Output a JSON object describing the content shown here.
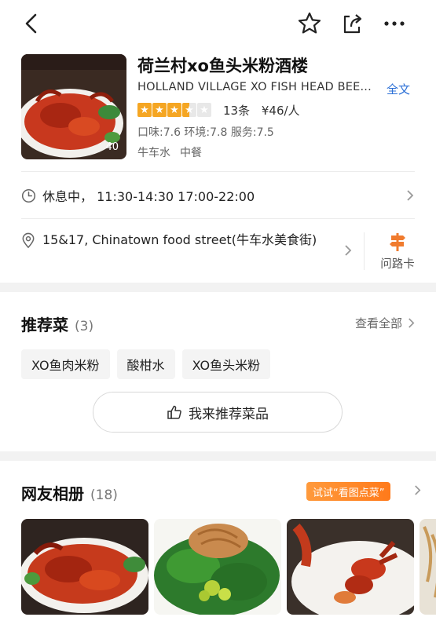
{
  "restaurant": {
    "name": "荷兰村xo鱼头米粉酒楼",
    "english_name": "HOLLAND VILLAGE XO FISH HEAD BEE...",
    "full_text_link": "全文",
    "photo_count": "40",
    "rating_stars": 3.5,
    "reviews": "13条",
    "price": "¥46/人",
    "scores": "口味:7.6 环境:7.8 服务:7.5",
    "area": "牛车水",
    "cuisine": "中餐"
  },
  "hours": {
    "text": "休息中，  11:30-14:30 17:00-22:00"
  },
  "address": {
    "text": "15&17, Chinatown food street(牛车水美食街)"
  },
  "direction_card": {
    "label": "问路卡"
  },
  "recommend": {
    "title": "推荐菜",
    "count": "(3)",
    "see_all": "查看全部",
    "dishes": [
      "XO鱼肉米粉",
      "酸柑水",
      "XO鱼头米粉"
    ],
    "button_label": "我来推荐菜品"
  },
  "album": {
    "title": "网友相册",
    "count": "(18)",
    "try_badge": "试试“看图点菜”"
  },
  "colors": {
    "star": "#f5a623",
    "link": "#2b6fd6",
    "badge": "#ff8a2a"
  },
  "icons": [
    "back-icon",
    "star-outline-icon",
    "share-icon",
    "more-icon",
    "clock-icon",
    "location-icon",
    "signpost-icon",
    "thumbs-up-icon",
    "chevron-right-icon"
  ]
}
